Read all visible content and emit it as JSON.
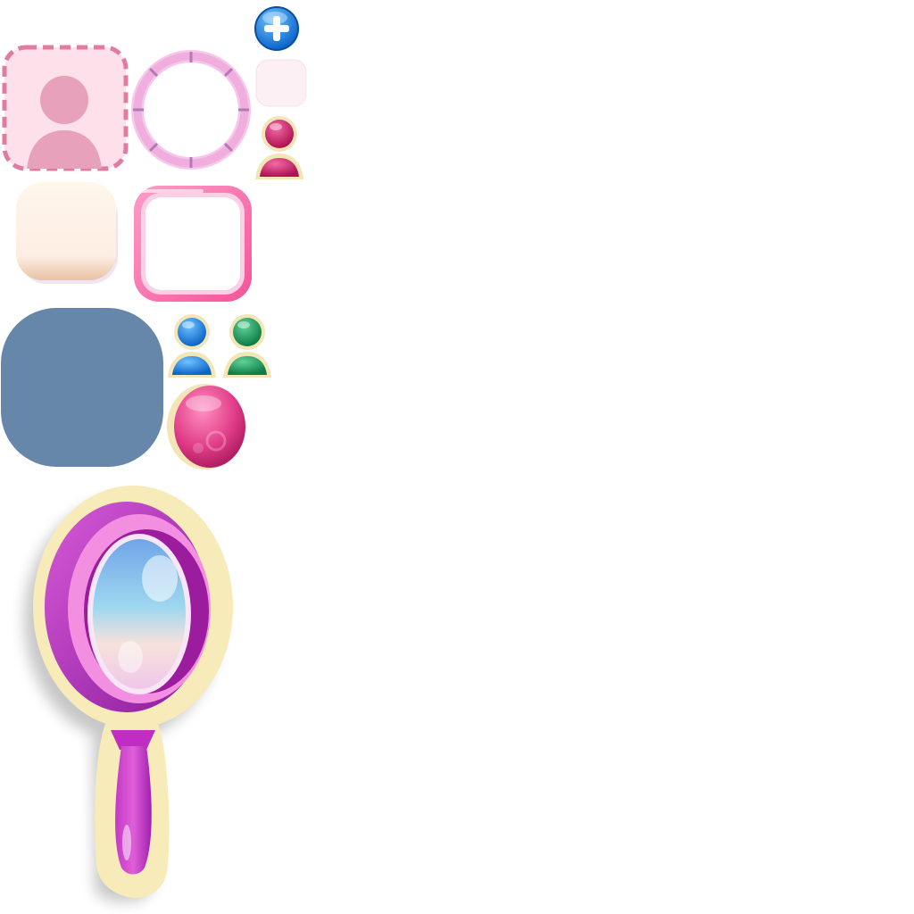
{
  "sheet": {
    "background": "#ffffff",
    "sprites": [
      {
        "name": "avatar-placeholder-dashed",
        "icon": "user-silhouette-icon",
        "colors": {
          "fill": "#fde0ea",
          "dash": "#e07ca2",
          "figure": "#e8a1bb"
        }
      },
      {
        "name": "avatar-ring-frame",
        "icon": "segmented-ring-icon",
        "colors": {
          "ring": "#f0aede",
          "tick": "#b07bb2"
        }
      },
      {
        "name": "add-button",
        "icon": "plus-circle-icon",
        "colors": {
          "fill": "#1e88e5",
          "plus": "#ffffff"
        }
      },
      {
        "name": "blank-tile-pale-pink",
        "icon": "rounded-square-icon",
        "colors": {
          "fill": "#fdf0f5"
        }
      },
      {
        "name": "user-badge-magenta",
        "icon": "user-icon",
        "colors": {
          "fill": "#d6246e",
          "outline": "#f3e5b5"
        }
      },
      {
        "name": "cream-cushion-tile",
        "icon": "rounded-square-icon",
        "colors": {
          "fill": "#fdeee3",
          "shadow": "#e8c2a6"
        }
      },
      {
        "name": "pink-glossy-frame",
        "icon": "square-frame-icon",
        "colors": {
          "frame": "#f970ad",
          "inner": "#ffffff"
        }
      },
      {
        "name": "slate-panel",
        "icon": "rounded-square-icon",
        "colors": {
          "fill": "#6687aa"
        }
      },
      {
        "name": "user-badge-blue",
        "icon": "user-icon",
        "colors": {
          "fill": "#1e88e5",
          "outline": "#f3e5b5"
        }
      },
      {
        "name": "user-badge-green",
        "icon": "user-icon",
        "colors": {
          "fill": "#1b9a5c",
          "outline": "#f3e5b5"
        }
      },
      {
        "name": "magenta-gem-button",
        "icon": "gem-button-icon",
        "colors": {
          "fill": "#e13d88",
          "rim": "#f3e5b5"
        }
      },
      {
        "name": "hand-mirror",
        "icon": "hand-mirror-icon",
        "colors": {
          "frame": "#b42ac0",
          "border": "#f7ebb9",
          "glass_top": "#8fc9ef",
          "glass_bottom": "#f4d8ea"
        }
      }
    ]
  }
}
